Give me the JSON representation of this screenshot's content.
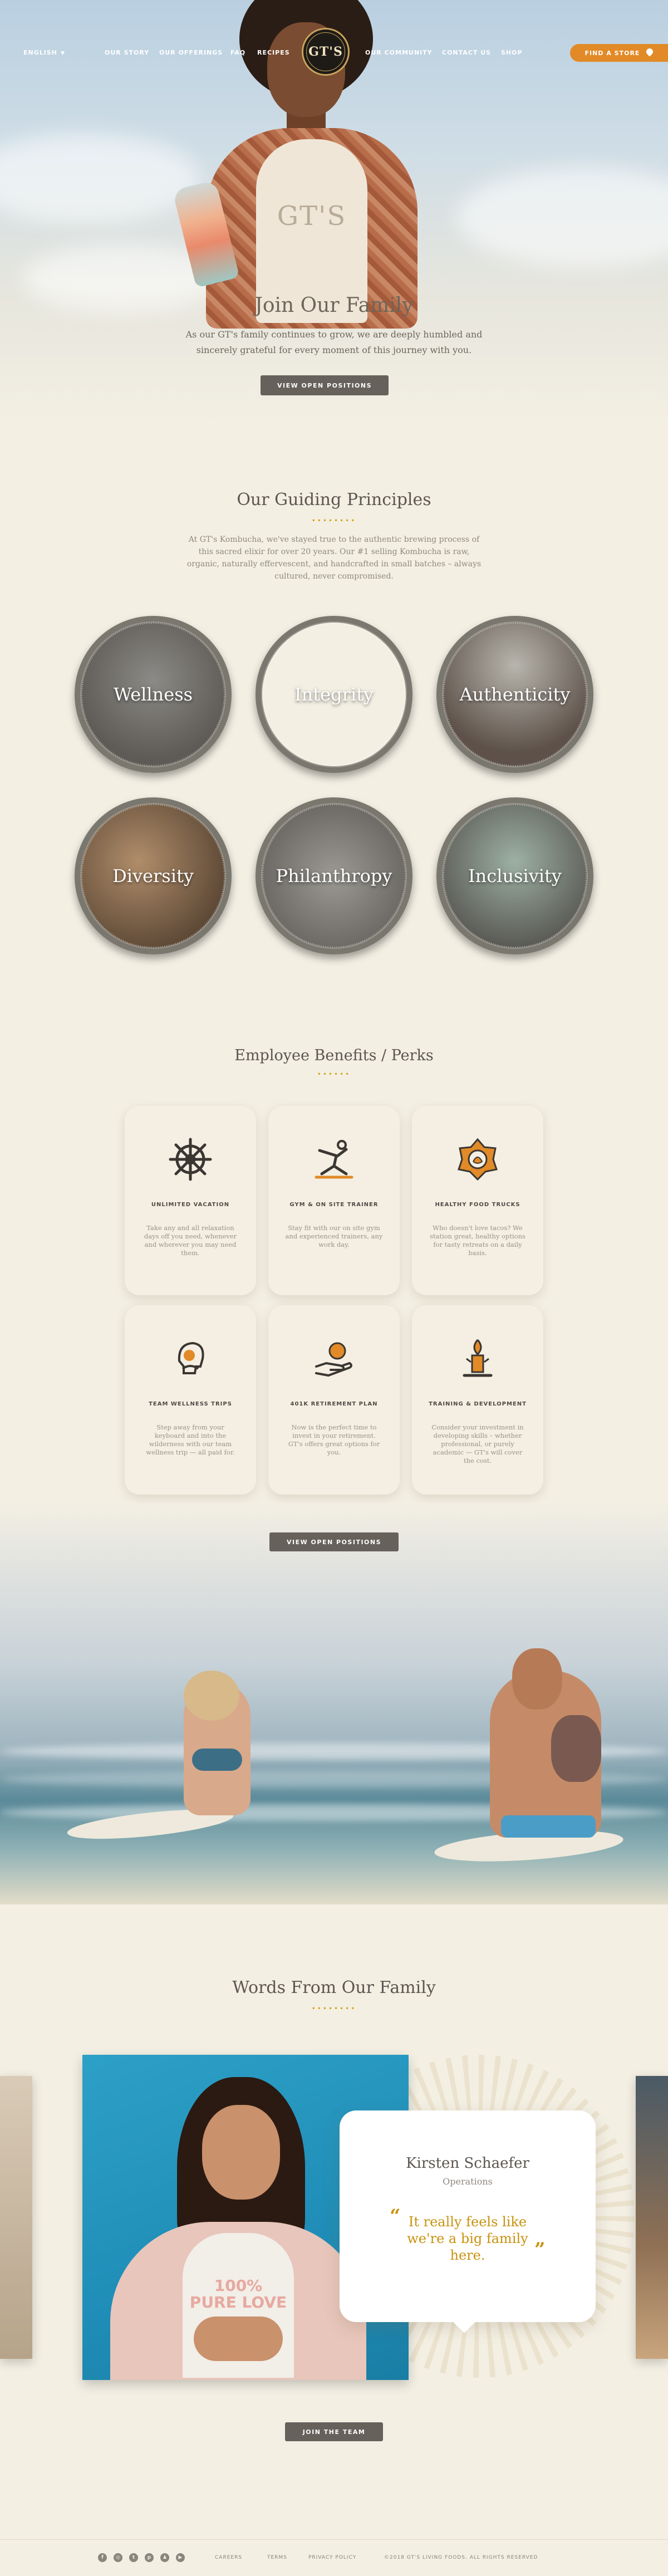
{
  "nav": {
    "language": "ENGLISH",
    "links": [
      "OUR STORY",
      "OUR OFFERINGS",
      "FAQ",
      "RECIPES",
      "OUR COMMUNITY",
      "CONTACT US",
      "SHOP"
    ],
    "logo_text": "GT'S",
    "find_store": "FIND A STORE"
  },
  "hero": {
    "title": "Join Our Family",
    "subtitle": "As our GT's family continues to grow, we are deeply humbled and sincerely grateful for every moment of this journey with you.",
    "button": "VIEW OPEN POSITIONS",
    "tee_print": "GT'S"
  },
  "principles": {
    "title": "Our Guiding Principles",
    "dots": "••••••••",
    "body": "At GT's Kombucha, we've stayed true to the authentic brewing process of this sacred elixir for over 20 years. Our #1 selling Kombucha is raw, organic, naturally effervescent, and handcrafted in small batches – always cultured, never compromised.",
    "items": [
      "Wellness",
      "Integrity",
      "Authenticity",
      "Diversity",
      "Philanthropy",
      "Inclusivity"
    ]
  },
  "benefits": {
    "title": "Employee Benefits / Perks",
    "dots": "••••••",
    "cards": [
      {
        "title": "UNLIMITED VACATION",
        "text": "Take any and all relaxation days off you need, whenever and wherever you may need them.",
        "icon": "ship-wheel-icon"
      },
      {
        "title": "GYM & ON SITE TRAINER",
        "text": "Stay fit with our on site gym and experienced trainers, any work day.",
        "icon": "yoga-pose-icon"
      },
      {
        "title": "HEALTHY FOOD TRUCKS",
        "text": "Who doesn't love tacos? We station great, healthy options for tasty retreats on a daily basis.",
        "icon": "lotus-badge-icon"
      },
      {
        "title": "TEAM WELLNESS TRIPS",
        "text": "Step away from your keyboard and into the wilderness with our team wellness trip — all paid for.",
        "icon": "team-head-icon"
      },
      {
        "title": "401K RETIREMENT PLAN",
        "text": "Now is the perfect time to invest in your retirement. GT's offers great options for you.",
        "icon": "hand-coin-icon"
      },
      {
        "title": "TRAINING & DEVELOPMENT",
        "text": "Consider your investment in developing skills – whether professional, or purely academic — GT's will cover the cost.",
        "icon": "torch-icon"
      }
    ],
    "button": "VIEW OPEN POSITIONS"
  },
  "testimonials": {
    "title": "Words From Our Family",
    "dots": "••••••••",
    "name": "Kirsten Schaefer",
    "role": "Operations",
    "quote": "It really feels like we're a big family here.",
    "open_quote": "“",
    "close_quote": "”",
    "shirt_print": "100% PURE LOVE",
    "button": "JOIN THE TEAM"
  },
  "footer": {
    "social": [
      {
        "icon": "facebook-icon",
        "glyph": "f"
      },
      {
        "icon": "instagram-icon",
        "glyph": "◎"
      },
      {
        "icon": "twitter-icon",
        "glyph": "t"
      },
      {
        "icon": "pinterest-icon",
        "glyph": "p"
      },
      {
        "icon": "snapchat-icon",
        "glyph": "♟"
      },
      {
        "icon": "youtube-icon",
        "glyph": "▶"
      }
    ],
    "links": [
      "CAREERS",
      "TERMS",
      "PRIVACY POLICY"
    ],
    "copyright": "©2018 GT'S LIVING FOODS. ALL RIGHTS RESERVED"
  },
  "colors": {
    "accent_orange": "#e18a27",
    "dots_gold": "#d4a21b",
    "button_gray": "#66615a",
    "page_bg": "#f3efe3"
  }
}
